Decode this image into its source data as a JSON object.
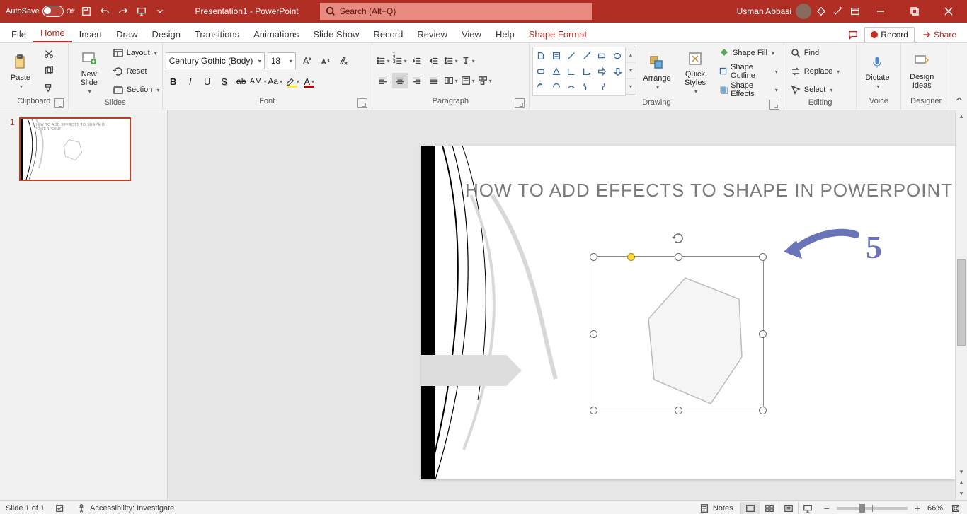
{
  "titlebar": {
    "autosave_label": "AutoSave",
    "autosave_state": "Off",
    "doc_title": "Presentation1 - PowerPoint",
    "search_placeholder": "Search (Alt+Q)",
    "user_name": "Usman Abbasi"
  },
  "tabs": {
    "file": "File",
    "home": "Home",
    "insert": "Insert",
    "draw": "Draw",
    "design": "Design",
    "transitions": "Transitions",
    "animations": "Animations",
    "slideshow": "Slide Show",
    "record": "Record",
    "review": "Review",
    "view": "View",
    "help": "Help",
    "shape_format": "Shape Format",
    "record_btn": "Record",
    "share_btn": "Share"
  },
  "ribbon": {
    "clipboard": {
      "label": "Clipboard",
      "paste": "Paste"
    },
    "slides": {
      "label": "Slides",
      "new_slide": "New\nSlide",
      "layout": "Layout",
      "reset": "Reset",
      "section": "Section"
    },
    "font": {
      "label": "Font",
      "name": "Century Gothic (Body)",
      "size": "18"
    },
    "paragraph": {
      "label": "Paragraph"
    },
    "drawing": {
      "label": "Drawing",
      "arrange": "Arrange",
      "quick_styles": "Quick\nStyles",
      "shape_fill": "Shape Fill",
      "shape_outline": "Shape Outline",
      "shape_effects": "Shape Effects"
    },
    "editing": {
      "label": "Editing",
      "find": "Find",
      "replace": "Replace",
      "select": "Select"
    },
    "voice": {
      "label": "Voice",
      "dictate": "Dictate"
    },
    "designer": {
      "label": "Designer",
      "design_ideas": "Design\nIdeas"
    }
  },
  "thumbs": {
    "slide1_num": "1",
    "slide1_title": "HOW TO ADD EFFECTS TO SHAPE IN POWERPOINT"
  },
  "slide": {
    "title": "HOW TO ADD EFFECTS TO SHAPE IN POWERPOINT",
    "annotation_num": "5"
  },
  "status": {
    "slide_info": "Slide 1 of 1",
    "accessibility": "Accessibility: Investigate",
    "notes": "Notes",
    "zoom": "66%"
  }
}
